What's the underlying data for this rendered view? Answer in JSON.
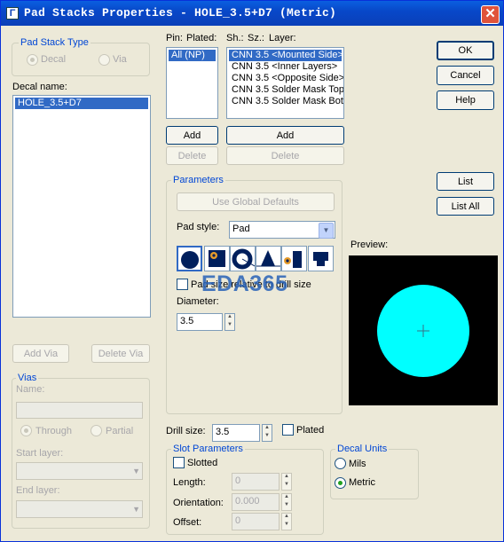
{
  "window": {
    "title": "Pad Stacks Properties - HOLE_3.5+D7 (Metric)"
  },
  "pad_stack_type": {
    "title": "Pad Stack Type",
    "decal_label": "Decal",
    "via_label": "Via",
    "selected": "Decal"
  },
  "decal_name": {
    "label": "Decal name:",
    "items": [
      "HOLE_3.5+D7"
    ]
  },
  "pin_list": {
    "pin_header": "Pin:",
    "plated_header": "Plated:",
    "items": [
      "All (NP)"
    ]
  },
  "layer_list": {
    "sh_header": "Sh.:",
    "sz_header": "Sz.:",
    "layer_header": "Layer:",
    "items": [
      "CNN 3.5 <Mounted Side>",
      "CNN 3.5 <Inner Layers>",
      "CNN 3.5 <Opposite Side>",
      "CNN 3.5 Solder Mask Top",
      "CNN 3.5 Solder Mask Botto"
    ]
  },
  "buttons": {
    "ok": "OK",
    "cancel": "Cancel",
    "help": "Help",
    "list": "List",
    "list_all": "List All",
    "add_pin": "Add",
    "delete_pin": "Delete",
    "add_layer": "Add",
    "delete_layer": "Delete",
    "add_via": "Add Via",
    "delete_via": "Delete Via"
  },
  "parameters": {
    "title": "Parameters",
    "use_global_defaults": "Use Global Defaults",
    "pad_style_label": "Pad style:",
    "pad_style_value": "Pad",
    "pad_relative_label": "Pad size relative to drill size",
    "diameter_label": "Diameter:",
    "diameter_value": "3.5"
  },
  "preview": {
    "label": "Preview:",
    "pad_color": "#00ffff"
  },
  "watermark": "EDA365",
  "vias": {
    "title": "Vias",
    "name_label": "Name:",
    "through_label": "Through",
    "partial_label": "Partial",
    "start_layer_label": "Start layer:",
    "end_layer_label": "End layer:"
  },
  "drill": {
    "label": "Drill size:",
    "value": "3.5",
    "plated_label": "Plated"
  },
  "slot_parameters": {
    "title": "Slot Parameters",
    "slotted_label": "Slotted",
    "length_label": "Length:",
    "length_value": "0",
    "orientation_label": "Orientation:",
    "orientation_value": "0.000",
    "offset_label": "Offset:",
    "offset_value": "0"
  },
  "decal_units": {
    "title": "Decal Units",
    "mils_label": "Mils",
    "metric_label": "Metric",
    "selected": "Metric"
  }
}
